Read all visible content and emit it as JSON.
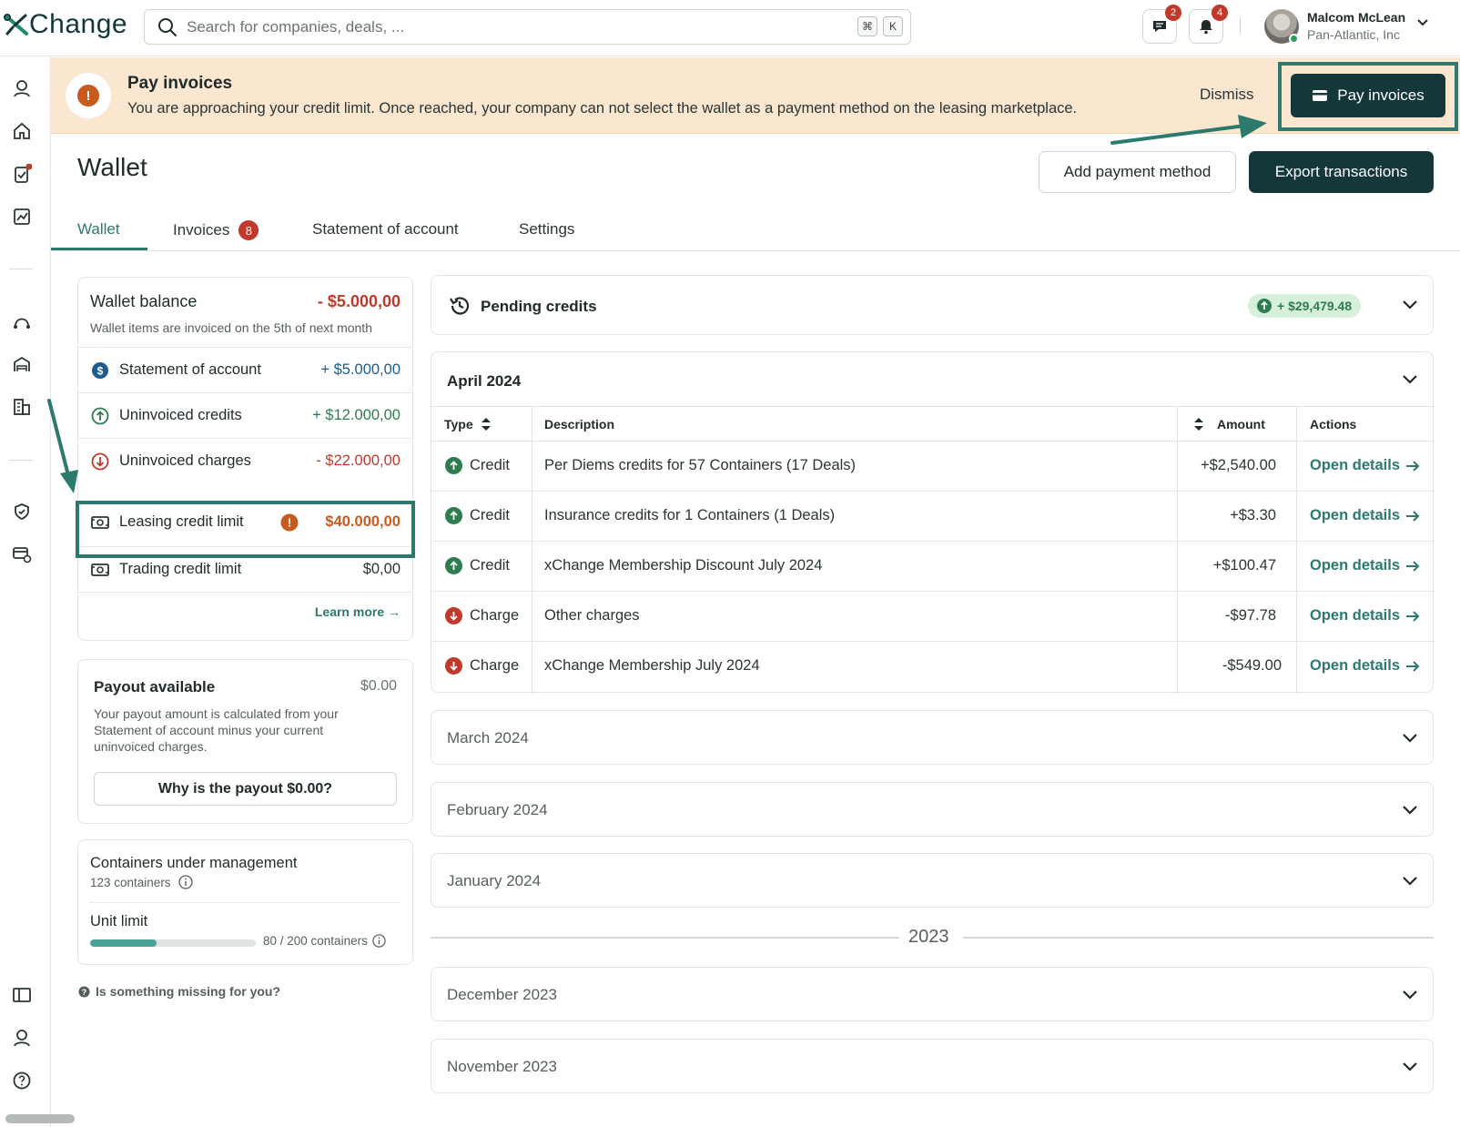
{
  "app": {
    "brand": "Change"
  },
  "search": {
    "placeholder": "Search for companies, deals, ...",
    "kbd1": "⌘",
    "kbd2": "K"
  },
  "header_icons": {
    "messages_count": "2",
    "notifications_count": "4"
  },
  "user": {
    "name": "Malcom McLean",
    "company": "Pan-Atlantic, Inc"
  },
  "banner": {
    "title": "Pay invoices",
    "text": "You are approaching your credit limit. Once reached, your company can not select the wallet as a payment method on the leasing marketplace.",
    "dismiss": "Dismiss",
    "pay_label": "Pay invoices"
  },
  "page": {
    "title": "Wallet",
    "add_payment": "Add payment method",
    "export": "Export transactions"
  },
  "tabs": [
    {
      "label": "Wallet"
    },
    {
      "label": "Invoices",
      "count": "8"
    },
    {
      "label": "Statement of account"
    },
    {
      "label": "Settings"
    }
  ],
  "wallet": {
    "title": "Wallet balance",
    "value": "- $5.000,00",
    "subtitle": "Wallet items are invoiced on the 5th of next month",
    "rows": [
      {
        "label": "Statement of account",
        "value": "+ $5.000,00"
      },
      {
        "label": "Uninvoiced credits",
        "value": "+ $12.000,00"
      },
      {
        "label": "Uninvoiced charges",
        "value": "- $22.000,00"
      },
      {
        "label": "Leasing credit limit",
        "value": "$40.000,00"
      },
      {
        "label": "Trading credit limit",
        "value": "$0,00"
      }
    ],
    "learn_more": "Learn more →"
  },
  "payout": {
    "title": "Payout available",
    "value": "$0.00",
    "text": "Your payout amount is calculated from your Statement of account minus your current uninvoiced charges.",
    "button": "Why is the payout $0.00?"
  },
  "containers": {
    "title": "Containers under management",
    "count": "123 containers",
    "unit_title": "Unit limit",
    "unit_text": "80 / 200 containers",
    "unit_fraction": 0.4
  },
  "missing": "Is something missing for you?",
  "pending": {
    "label": "Pending credits",
    "amount": "+ $29,479.48"
  },
  "april": {
    "label": "April 2024",
    "headers": {
      "type": "Type",
      "description": "Description",
      "amount": "Amount",
      "actions": "Actions"
    },
    "rows": [
      {
        "type": "Credit",
        "description": "Per Diems  credits for 57 Containers (17 Deals)",
        "amount": "+$2,540.00",
        "action": "Open details"
      },
      {
        "type": "Credit",
        "description": "Insurance credits for 1 Containers (1 Deals)",
        "amount": "+$3.30",
        "action": "Open details"
      },
      {
        "type": "Credit",
        "description": "xChange Membership Discount July 2024",
        "amount": "+$100.47",
        "action": "Open details"
      },
      {
        "type": "Charge",
        "description": "Other charges",
        "amount": "-$97.78",
        "action": "Open details"
      },
      {
        "type": "Charge",
        "description": "xChange Membership July 2024",
        "amount": "-$549.00",
        "action": "Open details"
      }
    ]
  },
  "months_2024": [
    "March 2024",
    "February 2024",
    "January 2024"
  ],
  "year_label": "2023",
  "months_2023": [
    "December 2023",
    "November 2023"
  ],
  "colors": {
    "brand_dark": "#14383a",
    "accent": "#2c7a6e",
    "banner_bg": "#fbe6cf",
    "red": "#c0392b",
    "orange": "#c75a1d",
    "green": "#2e7d4f"
  }
}
